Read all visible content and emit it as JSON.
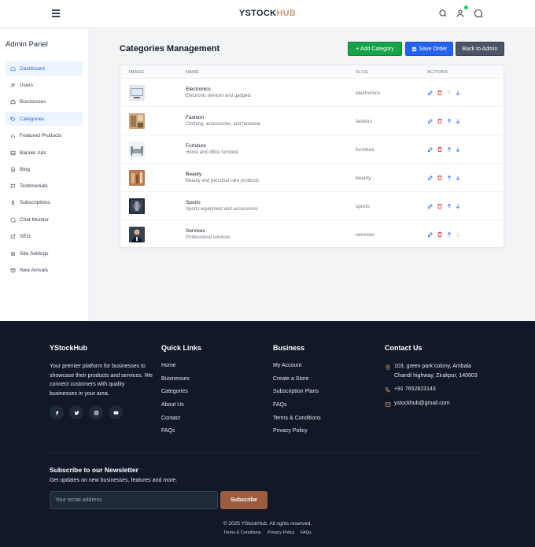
{
  "header": {
    "logo_part1": "YSTOCK",
    "logo_part2": "HUB",
    "icons": [
      "menu-icon",
      "search-icon",
      "user-icon",
      "chat-icon"
    ],
    "notification_color": "#22c55e"
  },
  "sidebar": {
    "title": "Admin Panel",
    "items": [
      {
        "label": "Dashboard",
        "icon": "home-icon",
        "active": true
      },
      {
        "label": "Users",
        "icon": "users-icon"
      },
      {
        "label": "Businesses",
        "icon": "briefcase-icon"
      },
      {
        "label": "Categories",
        "icon": "tag-icon",
        "active": true
      },
      {
        "label": "Featured Products",
        "icon": "chart-icon"
      },
      {
        "label": "Banner Ads",
        "icon": "image-icon"
      },
      {
        "label": "Blog",
        "icon": "document-icon"
      },
      {
        "label": "Testimonials",
        "icon": "comment-icon"
      },
      {
        "label": "Subscriptions",
        "icon": "dollar-icon"
      },
      {
        "label": "Chat Monitor",
        "icon": "chat-icon"
      },
      {
        "label": "SEO",
        "icon": "external-link-icon"
      },
      {
        "label": "Site Settings",
        "icon": "gear-icon"
      },
      {
        "label": "New Arrivals",
        "icon": "box-icon"
      }
    ]
  },
  "main": {
    "title": "Categories Management",
    "buttons": {
      "add": "+ Add Category",
      "save": "Save Order",
      "back": "Back to Admin"
    },
    "table": {
      "headers": [
        "IMAGE",
        "NAME",
        "SLUG",
        "ACTIONS"
      ],
      "rows": [
        {
          "name": "Electronics",
          "desc": "Electronic devices and gadgets",
          "slug": "electronics",
          "up_enabled": false,
          "down_enabled": true
        },
        {
          "name": "Fashion",
          "desc": "Clothing, accessories, and footwear",
          "slug": "fashion",
          "up_enabled": true,
          "down_enabled": true
        },
        {
          "name": "Furniture",
          "desc": "Home and office furniture",
          "slug": "furniture",
          "up_enabled": true,
          "down_enabled": true
        },
        {
          "name": "Beauty",
          "desc": "Beauty and personal care products",
          "slug": "beauty",
          "up_enabled": true,
          "down_enabled": true
        },
        {
          "name": "Sports",
          "desc": "Sports equipment and accessories",
          "slug": "sports",
          "up_enabled": true,
          "down_enabled": true
        },
        {
          "name": "Services",
          "desc": "Professional services",
          "slug": "services",
          "up_enabled": true,
          "down_enabled": false
        }
      ]
    }
  },
  "footer": {
    "brand": {
      "title": "YStockHub",
      "description": "Your premier platform for businesses to showcase their products and services. We connect customers with quality businesses in your area.",
      "social": [
        "facebook-icon",
        "twitter-icon",
        "instagram-icon",
        "youtube-icon"
      ]
    },
    "quick_links": {
      "title": "Quick Links",
      "items": [
        "Home",
        "Businesses",
        "Categories",
        "About Us",
        "Contact",
        "FAQs"
      ]
    },
    "business": {
      "title": "Business",
      "items": [
        "My Account",
        "Create a Store",
        "Subscription Plans",
        "FAQs",
        "Terms & Conditions",
        "Privacy Policy"
      ]
    },
    "contact": {
      "title": "Contact Us",
      "address": "103, green park colony, Ambala Chandi highway, Zirakpur, 140603",
      "phone": "+91 7652823143",
      "email": "ystockhub@gmail.com"
    },
    "newsletter": {
      "title": "Subscribe to our Newsletter",
      "subtitle": "Get updates on new businesses, features and more.",
      "placeholder": "Your email address",
      "button": "Subscribe"
    },
    "copyright": "© 2025 YStockHub. All rights reserved.",
    "legal": [
      "Terms & Conditions",
      "Privacy Policy",
      "FAQs"
    ]
  },
  "colors": {
    "primary_blue": "#2563eb",
    "success_green": "#16a34a",
    "danger_red": "#dc2626",
    "footer_bg": "#111827",
    "brand_brown": "#9c5d3e",
    "logo_accent": "#c79e7a"
  }
}
